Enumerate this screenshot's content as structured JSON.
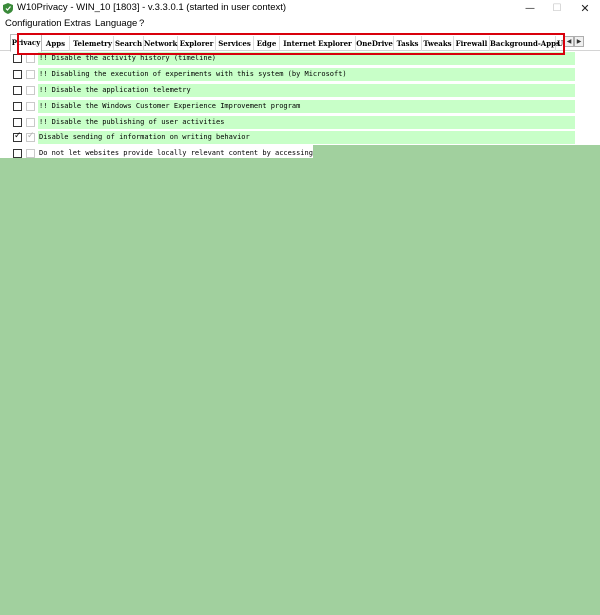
{
  "window": {
    "title": "W10Privacy - WIN_10 [1803]  - v.3.3.0.1 (started in user context)",
    "minimize": "—",
    "maximize": "☐",
    "close": "✕"
  },
  "menu": [
    "Configuration",
    "Extras",
    "Language",
    "?"
  ],
  "tabs": [
    {
      "label": "Privacy",
      "active": true
    },
    {
      "label": "Apps"
    },
    {
      "label": "Telemetry"
    },
    {
      "label": "Search"
    },
    {
      "label": "Network"
    },
    {
      "label": "Explorer"
    },
    {
      "label": "Services"
    },
    {
      "label": "Edge"
    },
    {
      "label": "Internet Explorer"
    },
    {
      "label": "OneDrive"
    },
    {
      "label": "Tasks"
    },
    {
      "label": "Tweaks"
    },
    {
      "label": "Firewall"
    },
    {
      "label": "Background-Apps"
    },
    {
      "label": "U"
    }
  ],
  "tab_scroll": {
    "left": "◀",
    "right": "▶"
  },
  "settings": [
    {
      "label": "!! Disable the activity history (timeline)",
      "checked": false
    },
    {
      "label": "!! Disabling the execution of experiments with this system (by Microsoft)",
      "checked": false
    },
    {
      "label": "!! Disable the application telemetry",
      "checked": false
    },
    {
      "label": "!! Disable the Windows Customer Experience Improvement program",
      "checked": false
    },
    {
      "label": "!! Disable the publishing of user activities",
      "checked": false
    },
    {
      "label": "Disable sending of information on writing behavior",
      "checked": true
    },
    {
      "label": "Do not let websites provide locally relevant content by accessing my lan",
      "checked": false
    }
  ],
  "colors": {
    "highlight_box": "#d8000c",
    "row_background": "#c8ffc8",
    "overlay": "#a1d09e"
  }
}
